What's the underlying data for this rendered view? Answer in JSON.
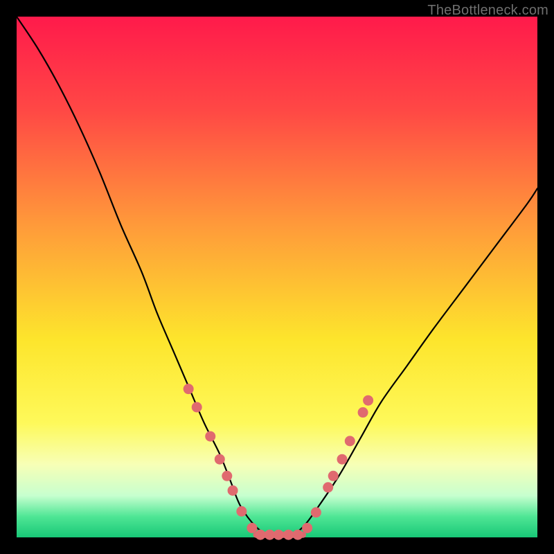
{
  "watermark": "TheBottleneck.com",
  "gradient": {
    "angle_deg": 180,
    "stops": [
      {
        "pct": 0,
        "color": "#ff1a4b"
      },
      {
        "pct": 18,
        "color": "#ff4845"
      },
      {
        "pct": 40,
        "color": "#ff9a3a"
      },
      {
        "pct": 62,
        "color": "#fde52c"
      },
      {
        "pct": 78,
        "color": "#fef95a"
      },
      {
        "pct": 86,
        "color": "#f7ffb6"
      },
      {
        "pct": 92,
        "color": "#c7ffcf"
      },
      {
        "pct": 96,
        "color": "#4fe695"
      },
      {
        "pct": 100,
        "color": "#18c877"
      }
    ]
  },
  "colors": {
    "curve_stroke": "#000000",
    "dot_fill": "#e06a6f",
    "floor_stroke": "#d46a6e"
  },
  "chart_data": {
    "type": "line",
    "title": "",
    "xlabel": "",
    "ylabel": "",
    "xlim": [
      0,
      100
    ],
    "ylim": [
      0,
      100
    ],
    "series": [
      {
        "name": "bottleneck-curve",
        "x": [
          0,
          4,
          8,
          12,
          16,
          20,
          24,
          27,
          30,
          33,
          36,
          39,
          41,
          43,
          46,
          49,
          52,
          55,
          58,
          62,
          66,
          70,
          75,
          80,
          86,
          92,
          98,
          100
        ],
        "values": [
          100,
          94,
          87,
          79,
          70,
          60,
          51,
          43,
          36,
          29,
          22,
          16,
          11,
          6,
          2,
          0,
          0,
          2,
          6,
          12,
          19,
          26,
          33,
          40,
          48,
          56,
          64,
          67
        ]
      }
    ],
    "floor_segment": {
      "x": [
        46,
        55
      ],
      "y": 0.5
    },
    "dots": {
      "left": [
        {
          "x": 33.0,
          "y": 28.5
        },
        {
          "x": 34.6,
          "y": 25.0
        },
        {
          "x": 37.2,
          "y": 19.4
        },
        {
          "x": 39.0,
          "y": 15.0
        },
        {
          "x": 40.4,
          "y": 11.8
        },
        {
          "x": 41.5,
          "y": 9.0
        },
        {
          "x": 43.2,
          "y": 5.0
        },
        {
          "x": 45.2,
          "y": 1.8
        }
      ],
      "right": [
        {
          "x": 55.8,
          "y": 1.8
        },
        {
          "x": 57.5,
          "y": 4.8
        },
        {
          "x": 59.8,
          "y": 9.6
        },
        {
          "x": 60.8,
          "y": 11.8
        },
        {
          "x": 62.5,
          "y": 15.0
        },
        {
          "x": 64.0,
          "y": 18.5
        },
        {
          "x": 66.5,
          "y": 24.0
        },
        {
          "x": 67.5,
          "y": 26.3
        }
      ],
      "bottom": [
        {
          "x": 46.8,
          "y": 0.5
        },
        {
          "x": 48.6,
          "y": 0.5
        },
        {
          "x": 50.3,
          "y": 0.5
        },
        {
          "x": 52.2,
          "y": 0.5
        },
        {
          "x": 54.0,
          "y": 0.5
        }
      ]
    }
  }
}
